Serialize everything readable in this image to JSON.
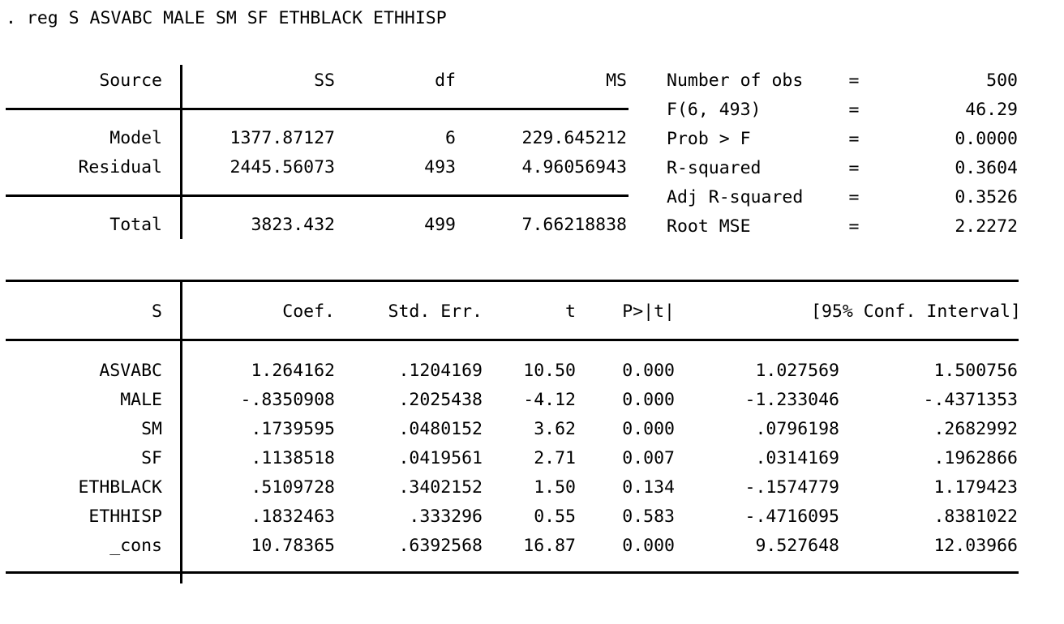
{
  "command": {
    "prompt": ".",
    "text": ". reg S ASVABC MALE SM SF ETHBLACK ETHHISP"
  },
  "anova": {
    "headers": {
      "source": "Source",
      "ss": "SS",
      "df": "df",
      "ms": "MS"
    },
    "rows": [
      {
        "source": "Model",
        "ss": "1377.87127",
        "df": "6",
        "ms": "229.645212"
      },
      {
        "source": "Residual",
        "ss": "2445.56073",
        "df": "493",
        "ms": "4.96056943"
      }
    ],
    "total": {
      "source": "Total",
      "ss": "3823.432",
      "df": "499",
      "ms": "7.66218838"
    }
  },
  "stats": [
    {
      "label": "Number of obs",
      "eq": "=",
      "value": "500"
    },
    {
      "label": "F(6, 493)",
      "eq": "=",
      "value": "46.29"
    },
    {
      "label": "Prob > F",
      "eq": "=",
      "value": "0.0000"
    },
    {
      "label": "R-squared",
      "eq": "=",
      "value": "0.3604"
    },
    {
      "label": "Adj R-squared",
      "eq": "=",
      "value": "0.3526"
    },
    {
      "label": "Root MSE",
      "eq": "=",
      "value": "2.2272"
    }
  ],
  "coefficients": {
    "headers": {
      "depvar": "S",
      "coef": "Coef.",
      "stderr": "Std. Err.",
      "t": "t",
      "p": "P>|t|",
      "ci": "[95% Conf. Interval]"
    },
    "rows": [
      {
        "term": "ASVABC",
        "coef": "1.264162",
        "stderr": ".1204169",
        "t": "10.50",
        "p": "0.000",
        "ci_low": "1.027569",
        "ci_high": "1.500756"
      },
      {
        "term": "MALE",
        "coef": "-.8350908",
        "stderr": ".2025438",
        "t": "-4.12",
        "p": "0.000",
        "ci_low": "-1.233046",
        "ci_high": "-.4371353"
      },
      {
        "term": "SM",
        "coef": ".1739595",
        "stderr": ".0480152",
        "t": "3.62",
        "p": "0.000",
        "ci_low": ".0796198",
        "ci_high": ".2682992"
      },
      {
        "term": "SF",
        "coef": ".1138518",
        "stderr": ".0419561",
        "t": "2.71",
        "p": "0.007",
        "ci_low": ".0314169",
        "ci_high": ".1962866"
      },
      {
        "term": "ETHBLACK",
        "coef": ".5109728",
        "stderr": ".3402152",
        "t": "1.50",
        "p": "0.134",
        "ci_low": "-.1574779",
        "ci_high": "1.179423"
      },
      {
        "term": "ETHHISP",
        "coef": ".1832463",
        "stderr": ".333296",
        "t": "0.55",
        "p": "0.583",
        "ci_low": "-.4716095",
        "ci_high": ".8381022"
      },
      {
        "term": "_cons",
        "coef": "10.78365",
        "stderr": ".6392568",
        "t": "16.87",
        "p": "0.000",
        "ci_low": "9.527648",
        "ci_high": "12.03966"
      }
    ]
  },
  "colors": {
    "background": "#ffffff",
    "text": "#000000",
    "rule": "#000000"
  }
}
